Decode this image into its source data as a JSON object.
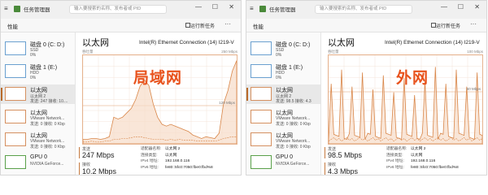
{
  "windows": [
    {
      "title": "任务管理器",
      "search_placeholder": "输入要搜索的名称、发布者或 PID",
      "window_controls": [
        "—",
        "☐",
        "✕"
      ],
      "section": "性能",
      "run_task": "运行新任务",
      "more": "···",
      "sidebar": [
        {
          "title": "磁盘 0 (C: D:)",
          "line2": "SSD",
          "line3": "0%",
          "kind": "disk"
        },
        {
          "title": "磁盘 1 (E:)",
          "line2": "HDD",
          "line3": "0%",
          "kind": "disk"
        },
        {
          "title": "以太网",
          "line2": "以太网 2",
          "line3": "发送: 247 接收: 10....",
          "kind": "eth",
          "selected": true
        },
        {
          "title": "以太网",
          "line2": "VMware Network...",
          "line3": "发送: 0 接收: 0 Kbp",
          "kind": "eth2"
        },
        {
          "title": "以太网",
          "line2": "VMware Network...",
          "line3": "发送: 0 接收: 0 Kbp",
          "kind": "eth2"
        },
        {
          "title": "GPU 0",
          "line2": "NVIDIA GeForce...",
          "line3": "",
          "kind": "gpu"
        }
      ],
      "heading": "以太网",
      "adapter": "Intel(R) Ethernet Connection (14) I219-V",
      "throughput_label": "吞吐量",
      "max_label": "250 Mbps",
      "mid_label": "120 Mbps",
      "overlay": "局域网",
      "send_label": "发送",
      "send_value": "247 Mbps",
      "recv_label": "接收",
      "recv_value": "10.2 Mbps",
      "props": [
        {
          "k": "适配器名称:",
          "v": "以太网 2"
        },
        {
          "k": "连接类型:",
          "v": "以太网"
        },
        {
          "k": "IPv4 地址:",
          "v": "192.168.0.116"
        },
        {
          "k": "IPv6 地址:",
          "v": "fe80::5fc0:7050:fbe0:fbd%8"
        }
      ]
    },
    {
      "title": "任务管理器",
      "search_placeholder": "输入要搜索的名称、发布者或 PID",
      "window_controls": [
        "—",
        "☐",
        "✕"
      ],
      "section": "性能",
      "run_task": "运行新任务",
      "more": "···",
      "sidebar": [
        {
          "title": "磁盘 0 (C: D:)",
          "line2": "SSD",
          "line3": "0%",
          "kind": "disk"
        },
        {
          "title": "磁盘 1 (E:)",
          "line2": "HDD",
          "line3": "0%",
          "kind": "disk"
        },
        {
          "title": "以太网",
          "line2": "以太网 2",
          "line3": "发送: 98.5 接收: 4.3",
          "kind": "eth",
          "selected": true
        },
        {
          "title": "以太网",
          "line2": "VMware Network...",
          "line3": "发送: 0 接收: 0 Kbp",
          "kind": "eth2"
        },
        {
          "title": "以太网",
          "line2": "VMware Network...",
          "line3": "发送: 0 接收: 0 Kbp",
          "kind": "eth2"
        },
        {
          "title": "GPU 0",
          "line2": "NVIDIA GeForce...",
          "line3": "",
          "kind": "gpu"
        }
      ],
      "heading": "以太网",
      "adapter": "Intel(R) Ethernet Connection (14) I219-V",
      "throughput_label": "吞吐量",
      "max_label": "100 Mbps",
      "mid_label": "50 Mbps",
      "overlay": "外网",
      "send_label": "发送",
      "send_value": "98.5 Mbps",
      "recv_label": "接收",
      "recv_value": "4.3 Mbps",
      "props": [
        {
          "k": "适配器名称:",
          "v": "以太网 2"
        },
        {
          "k": "连接类型:",
          "v": "以太网"
        },
        {
          "k": "IPv4 地址:",
          "v": "192.168.0.116"
        },
        {
          "k": "IPv6 地址:",
          "v": "fe80::5fc0:7050:fbe0:fbd%8"
        }
      ]
    }
  ],
  "colors": {
    "accent": "#e8521c",
    "line": "#d9874a",
    "fill": "#f6dcc8"
  }
}
